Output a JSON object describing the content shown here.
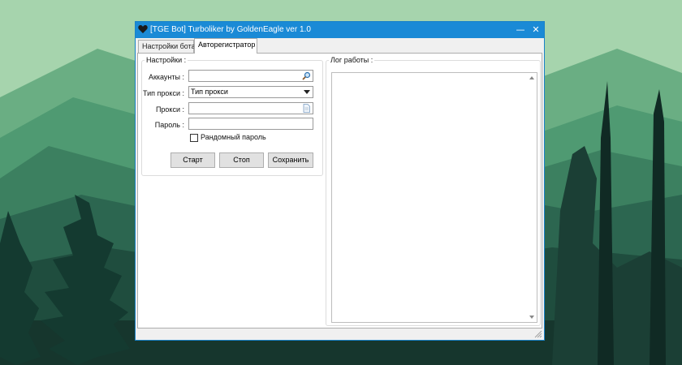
{
  "window": {
    "title": "[TGE Bot] Turboliker by GoldenEagle ver 1.0",
    "accent_color": "#1a8ad6",
    "controls": {
      "minimize": "—",
      "close": "✕"
    }
  },
  "tabs": [
    {
      "label": "Настройки бота",
      "active": false
    },
    {
      "label": "Авторегистратор",
      "active": true
    }
  ],
  "settings": {
    "group_label": "Настройки :",
    "accounts_label": "Аккаунты :",
    "accounts_value": "",
    "proxy_type_label": "Тип прокси :",
    "proxy_type_value": "Тип прокси",
    "proxies_label": "Прокси :",
    "proxies_value": "",
    "password_label": "Пароль :",
    "password_value": "",
    "random_password_label": "Рандомный пароль",
    "random_password_checked": false,
    "buttons": {
      "start": "Старт",
      "stop": "Стоп",
      "save": "Сохранить"
    }
  },
  "log": {
    "label": "Лог работы :",
    "content": ""
  },
  "icons": {
    "title": "heart-icon",
    "accounts_browse": "search-file-icon",
    "proxies_browse": "file-icon",
    "size_grip": "resize-grip-icon"
  }
}
